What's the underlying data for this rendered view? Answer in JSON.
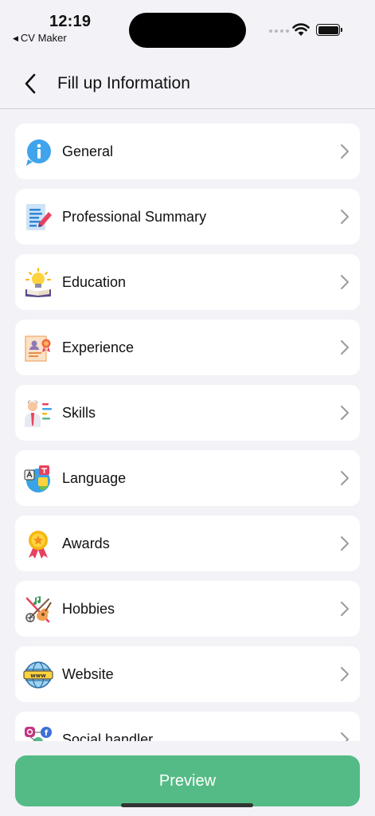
{
  "status_bar": {
    "time": "12:19",
    "back_app": "CV Maker"
  },
  "nav": {
    "title": "Fill up Information"
  },
  "sections": [
    {
      "label": "General",
      "icon": "info-icon"
    },
    {
      "label": "Professional Summary",
      "icon": "document-pen-icon"
    },
    {
      "label": "Education",
      "icon": "lightbulb-book-icon"
    },
    {
      "label": "Experience",
      "icon": "certificate-icon"
    },
    {
      "label": "Skills",
      "icon": "person-skills-icon"
    },
    {
      "label": "Language",
      "icon": "language-globe-icon"
    },
    {
      "label": "Awards",
      "icon": "medal-icon"
    },
    {
      "label": "Hobbies",
      "icon": "guitar-icon"
    },
    {
      "label": "Website",
      "icon": "www-globe-icon"
    },
    {
      "label": "Social handler",
      "icon": "social-media-icon"
    }
  ],
  "preview": {
    "label": "Preview"
  },
  "colors": {
    "accent": "#55bb86",
    "background": "#f2f2f7",
    "card": "#ffffff"
  }
}
